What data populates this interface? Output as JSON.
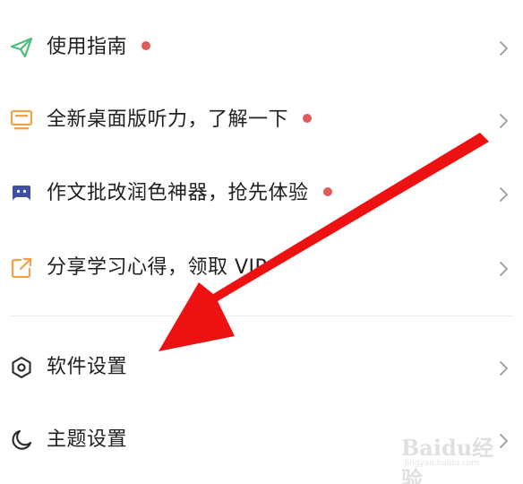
{
  "menu": {
    "items": [
      {
        "label": "使用指南",
        "icon": "paper-plane-icon",
        "has_dot": true
      },
      {
        "label": "全新桌面版听力，了解一下",
        "icon": "monitor-icon",
        "has_dot": true
      },
      {
        "label": "作文批改润色神器，抢先体验",
        "icon": "robot-icon",
        "has_dot": true
      },
      {
        "label": "分享学习心得，领取 VIP",
        "icon": "share-icon",
        "has_dot": false
      },
      {
        "label": "软件设置",
        "icon": "settings-hexagon-icon",
        "has_dot": false
      },
      {
        "label": "主题设置",
        "icon": "moon-icon",
        "has_dot": false
      }
    ]
  },
  "colors": {
    "dot": "#e05a5a",
    "green": "#4cbf7a",
    "orange": "#f0a24a",
    "indigo": "#3f4fa8",
    "text": "#1f1f1f",
    "chevron": "#9a9a9a",
    "arrow": "#ee1111"
  },
  "watermark": {
    "logo": "Baidu经验",
    "url": "jingyan.baidu.com"
  }
}
